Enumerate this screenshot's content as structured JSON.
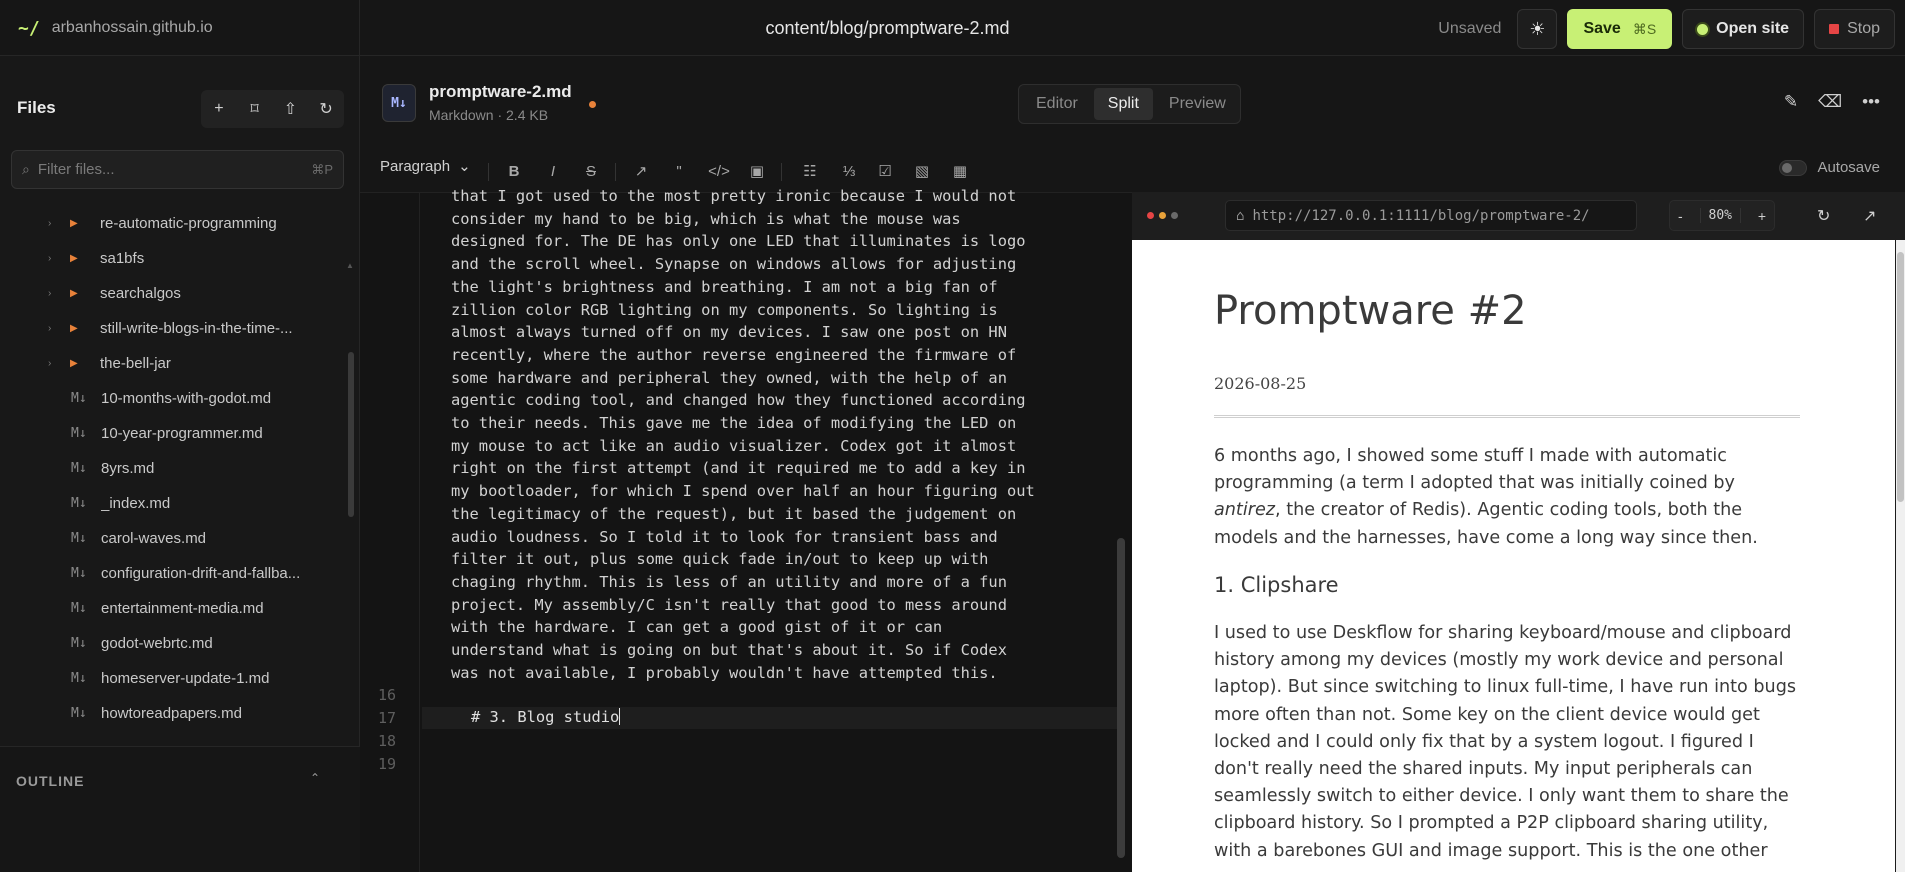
{
  "topbar": {
    "brand_mark": "~/",
    "site_name": "arbanhossain.github.io",
    "file_path": "content/blog/promptware-2.md",
    "status": "Unsaved",
    "theme_icon": "sun-icon",
    "save_label": "Save",
    "save_shortcut": "⌘S",
    "open_site_label": "Open site",
    "stop_label": "Stop",
    "accent": "#c8f075",
    "stop_color": "#e64545"
  },
  "sidebar": {
    "title": "Files",
    "tools": [
      "plus-icon",
      "new-folder-icon",
      "upload-icon",
      "refresh-icon"
    ],
    "filter_placeholder": "Filter files...",
    "filter_shortcut": "⌘P",
    "folders": [
      {
        "name": "re-automatic-programming"
      },
      {
        "name": "sa1bfs"
      },
      {
        "name": "searchalgos"
      },
      {
        "name": "still-write-blogs-in-the-time-..."
      },
      {
        "name": "the-bell-jar"
      }
    ],
    "files": [
      {
        "name": "10-months-with-godot.md"
      },
      {
        "name": "10-year-programmer.md"
      },
      {
        "name": "8yrs.md"
      },
      {
        "name": "_index.md"
      },
      {
        "name": "carol-waves.md"
      },
      {
        "name": "configuration-drift-and-fallba..."
      },
      {
        "name": "entertainment-media.md"
      },
      {
        "name": "godot-webrtc.md"
      },
      {
        "name": "homeserver-update-1.md"
      },
      {
        "name": "howtoreadpapers.md"
      }
    ],
    "outline_title": "OUTLINE",
    "folder_color": "#e8823a"
  },
  "document": {
    "badge": "M↓",
    "name": "promptware-2.md",
    "meta": "Markdown · 2.4 KB",
    "view_tabs": [
      "Editor",
      "Split",
      "Preview"
    ],
    "active_tab": "Split"
  },
  "toolbar": {
    "block_type": "Paragraph",
    "buttons": [
      "B",
      "I",
      "S",
      "↗",
      "\"",
      "</>",
      "▣",
      "☷",
      "⅓",
      "☑",
      "▧",
      "▦"
    ],
    "autosave_label": "Autosave"
  },
  "editor": {
    "line_numbers": [
      "16",
      "17",
      "18",
      "19"
    ],
    "paragraph_lines": [
      "that I got used to the most pretty ironic because I would not",
      "consider my hand to be big, which is what the mouse was",
      "designed for. The DE has only one LED that illuminates is logo",
      "and the scroll wheel. Synapse on windows allows for adjusting",
      "the light's brightness and breathing. I am not a big fan of",
      "zillion color RGB lighting on my components. So lighting is",
      "almost always turned off on my devices. I saw one post on HN",
      "recently, where the author reverse engineered the firmware of",
      "some hardware and peripheral they owned, with the help of an",
      "agentic coding tool, and changed how they functioned according",
      "to their needs. This gave me the idea of modifying the LED on",
      "my mouse to act like an audio visualizer. Codex got it almost",
      "right on the first attempt (and it required me to add a key in",
      "my bootloader, for which I spend over half an hour figuring out",
      "the legitimacy of the request), but it based the judgement on",
      "audio loudness. So I told it to look for transient bass and",
      "filter it out, plus some quick fade in/out to keep up with",
      "chaging rhythm. This is less of an utility and more of a fun",
      "project. My assembly/C isn't really that good to mess around",
      "with the hardware. I can get a good gist of it or can",
      "understand what is going on but that's about it. So if Codex",
      "was not available, I probably wouldn't have attempted this."
    ],
    "heading_line": "# 3. Blog studio"
  },
  "preview": {
    "url": "http://127.0.0.1:1111/blog/promptware-2/",
    "zoom": "80%",
    "zoom_minus": "-",
    "zoom_plus": "+",
    "title": "Promptware #2",
    "date": "2026-08-25",
    "intro_before": "6 months ago, I showed some stuff I made with automatic programming (a term I adopted that was initially coined by ",
    "intro_em": "antirez",
    "intro_after": ", the creator of Redis). Agentic coding tools, both the models and the harnesses, have come a long way since then.",
    "section_heading": "1. Clipshare",
    "section_para": "I used to use Deskflow for sharing keyboard/mouse and clipboard history among my devices (mostly my work device and personal laptop). But since switching to linux full-time, I have run into bugs more often than not. Some key on the client device would get locked and I could only fix that by a system logout. I figured I don't really need the shared inputs. My input peripherals can seamlessly switch to either device. I only want them to share the clipboard history. So I prompted a P2P clipboard sharing utility, with a barebones GUI and image support. This is the one other app"
  }
}
